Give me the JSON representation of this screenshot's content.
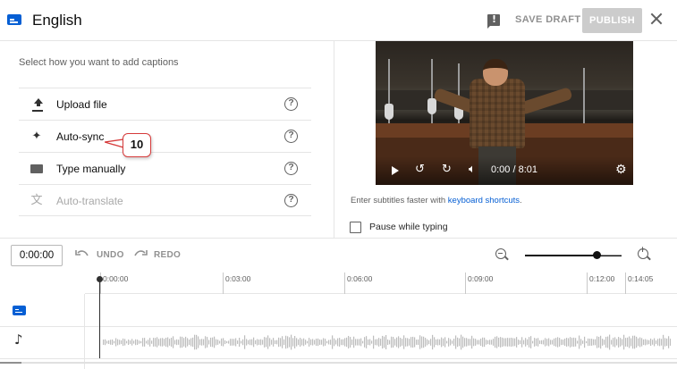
{
  "header": {
    "title": "English",
    "save_draft": "SAVE DRAFT",
    "publish": "PUBLISH"
  },
  "left_panel": {
    "prompt": "Select how you want to add captions",
    "methods": [
      {
        "label": "Upload file",
        "icon": "upload-icon",
        "help": "?"
      },
      {
        "label": "Auto-sync",
        "icon": "sparkle-icon",
        "help": "?"
      },
      {
        "label": "Type manually",
        "icon": "keyboard-icon",
        "help": "?"
      },
      {
        "label": "Auto-translate",
        "icon": "translate-icon",
        "help": "?",
        "disabled": true
      }
    ],
    "callout": "10"
  },
  "video": {
    "time": "0:00 / 8:01"
  },
  "editor": {
    "shortcut_prefix": "Enter subtitles faster with ",
    "shortcut_link": "keyboard shortcuts",
    "shortcut_suffix": ".",
    "pause_label": "Pause while typing",
    "pause_checked": false
  },
  "toolbar": {
    "time_value": "0:00:00",
    "undo": "UNDO",
    "redo": "REDO",
    "zoom_level": 0.75
  },
  "timeline": {
    "ticks": [
      "0:00:00",
      "0:03:00",
      "0:06:00",
      "0:09:00",
      "0:12:00",
      "0:14:05"
    ]
  },
  "colors": {
    "accent": "#065fd4",
    "callout_border": "#d63a3a",
    "publish_disabled": "#cccccc"
  }
}
